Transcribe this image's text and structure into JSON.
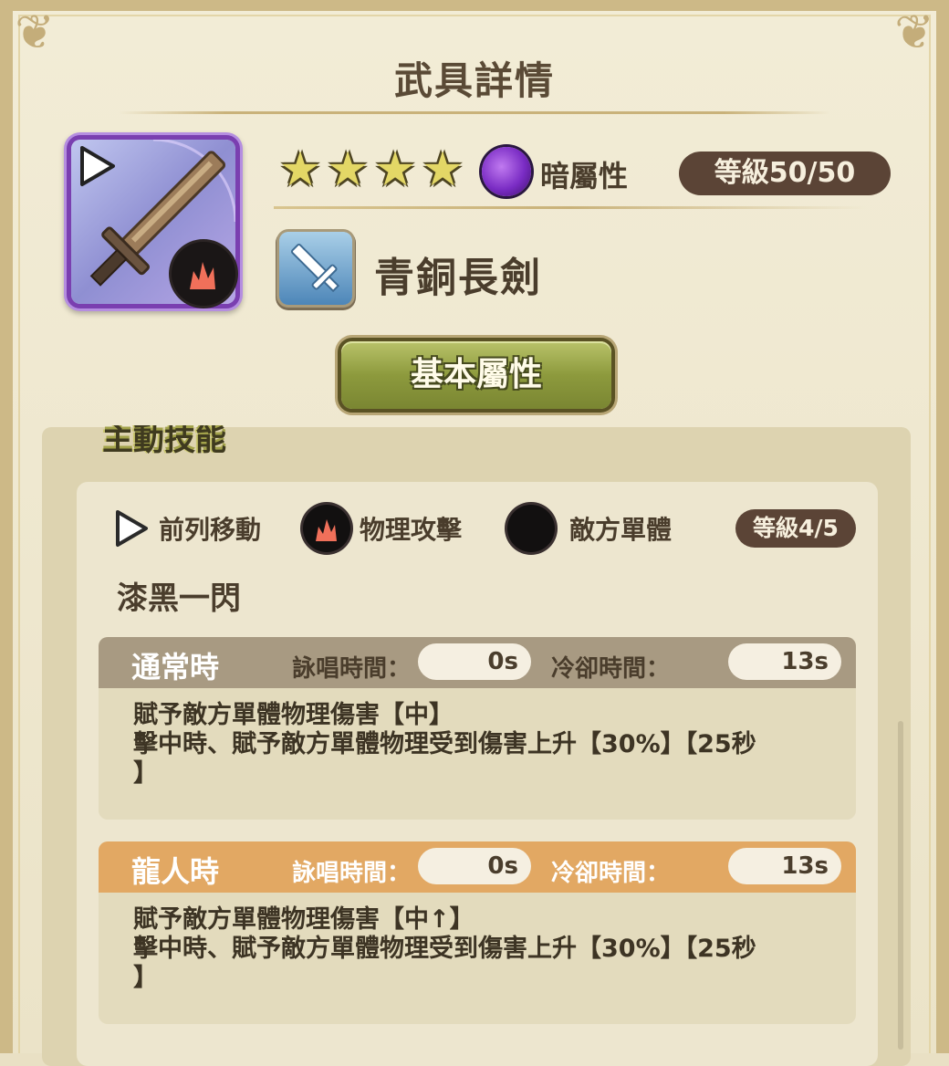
{
  "header": {
    "title": "武具詳情"
  },
  "weapon": {
    "rarity_stars": 4,
    "star_glyph": "★",
    "attribute": "暗屬性",
    "level": "等級50/50",
    "name": "青銅長劍",
    "colors": {
      "frame": "#7a3fb0",
      "attribute_orb": "#8a3bd0"
    }
  },
  "tab": {
    "label": "基本屬性"
  },
  "skill": {
    "section_title": "主動技能",
    "tags": [
      "前列移動",
      "物理攻擊",
      "敵方單體"
    ],
    "level": "等級4/5",
    "name": "漆黑一閃",
    "states": [
      {
        "name": "通常時",
        "cast_label": "詠唱時間：",
        "cast_value": "0s",
        "cooldown_label": "冷卻時間：",
        "cooldown_value": "13s",
        "desc_line1": "賦予敵方單體物理傷害【中】",
        "desc_line2": "擊中時、賦予敵方單體物理受到傷害上升【30%】【25秒",
        "desc_line3": "】",
        "color": "#a89a82"
      },
      {
        "name": "龍人時",
        "cast_label": "詠唱時間：",
        "cast_value": "0s",
        "cooldown_label": "冷卻時間：",
        "cooldown_value": "13s",
        "desc_line1": "賦予敵方單體物理傷害【中↑】",
        "desc_line2": "擊中時、賦予敵方單體物理受到傷害上升【30%】【25秒",
        "desc_line3": "】",
        "color": "#e2a863"
      }
    ]
  }
}
